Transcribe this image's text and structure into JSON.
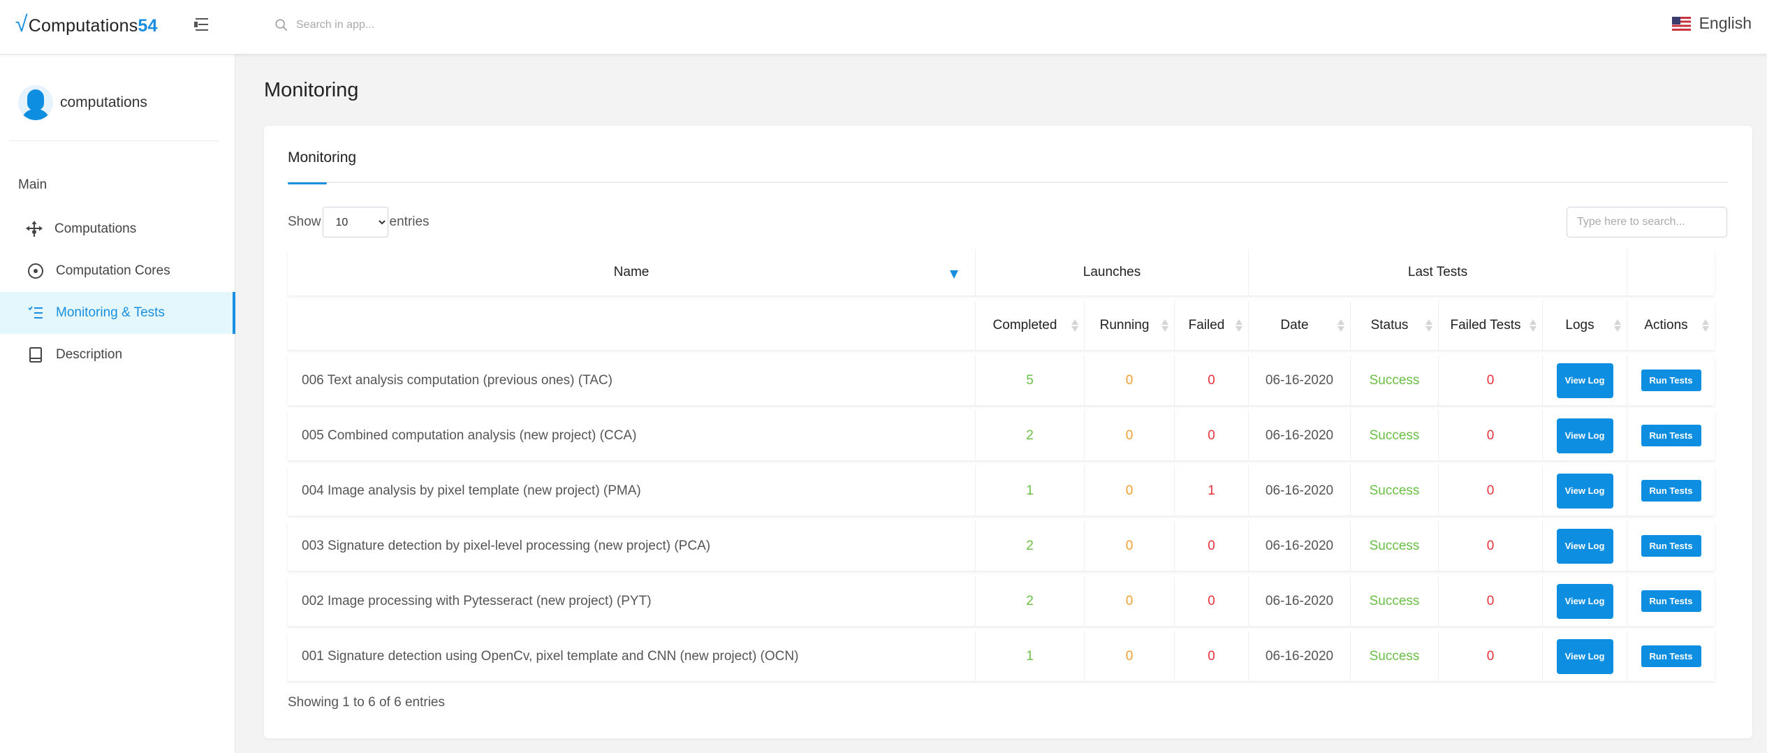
{
  "header": {
    "logo_prefix": "√",
    "logo_name": "Computations",
    "logo_suffix": "54",
    "search_placeholder": "Search in app...",
    "language": "English"
  },
  "sidebar": {
    "user_name": "computations",
    "section_label": "Main",
    "items": [
      {
        "label": "Computations",
        "icon": "network-arrows-icon",
        "active": false
      },
      {
        "label": "Computation Cores",
        "icon": "target-circle-icon",
        "active": false
      },
      {
        "label": "Monitoring & Tests",
        "icon": "checklist-icon",
        "active": true
      },
      {
        "label": "Description",
        "icon": "book-icon",
        "active": false
      }
    ]
  },
  "page": {
    "title": "Monitoring",
    "tab_label": "Monitoring"
  },
  "table_controls": {
    "show_label": "Show",
    "entries_label": "entries",
    "page_length": "10",
    "search_placeholder": "Type here to search..."
  },
  "table": {
    "group_headers": {
      "name": "Name",
      "launches": "Launches",
      "last_tests": "Last Tests"
    },
    "columns": {
      "completed": "Completed",
      "running": "Running",
      "failed": "Failed",
      "date": "Date",
      "status": "Status",
      "failed_tests": "Failed Tests",
      "logs": "Logs",
      "actions": "Actions"
    },
    "view_log_label": "View Log",
    "run_tests_label": "Run Tests",
    "rows": [
      {
        "name": "006 Text analysis computation (previous ones) (TAC)",
        "completed": "5",
        "running": "0",
        "failed": "0",
        "date": "06-16-2020",
        "status": "Success",
        "failed_tests": "0"
      },
      {
        "name": "005 Combined computation analysis (new project) (CCA)",
        "completed": "2",
        "running": "0",
        "failed": "0",
        "date": "06-16-2020",
        "status": "Success",
        "failed_tests": "0"
      },
      {
        "name": "004 Image analysis by pixel template (new project) (PMA)",
        "completed": "1",
        "running": "0",
        "failed": "1",
        "date": "06-16-2020",
        "status": "Success",
        "failed_tests": "0"
      },
      {
        "name": "003 Signature detection by pixel-level processing (new project) (PCA)",
        "completed": "2",
        "running": "0",
        "failed": "0",
        "date": "06-16-2020",
        "status": "Success",
        "failed_tests": "0"
      },
      {
        "name": "002 Image processing with Pytesseract (new project) (PYT)",
        "completed": "2",
        "running": "0",
        "failed": "0",
        "date": "06-16-2020",
        "status": "Success",
        "failed_tests": "0"
      },
      {
        "name": "001 Signature detection using OpenCv, pixel template and CNN (new project) (OCN)",
        "completed": "1",
        "running": "0",
        "failed": "0",
        "date": "06-16-2020",
        "status": "Success",
        "failed_tests": "0"
      }
    ],
    "info": "Showing 1 to 6 of 6 entries"
  },
  "colors": {
    "accent": "#1a8fe0",
    "success": "#6abf45",
    "warning": "#f0a030",
    "danger": "#e8323c"
  }
}
